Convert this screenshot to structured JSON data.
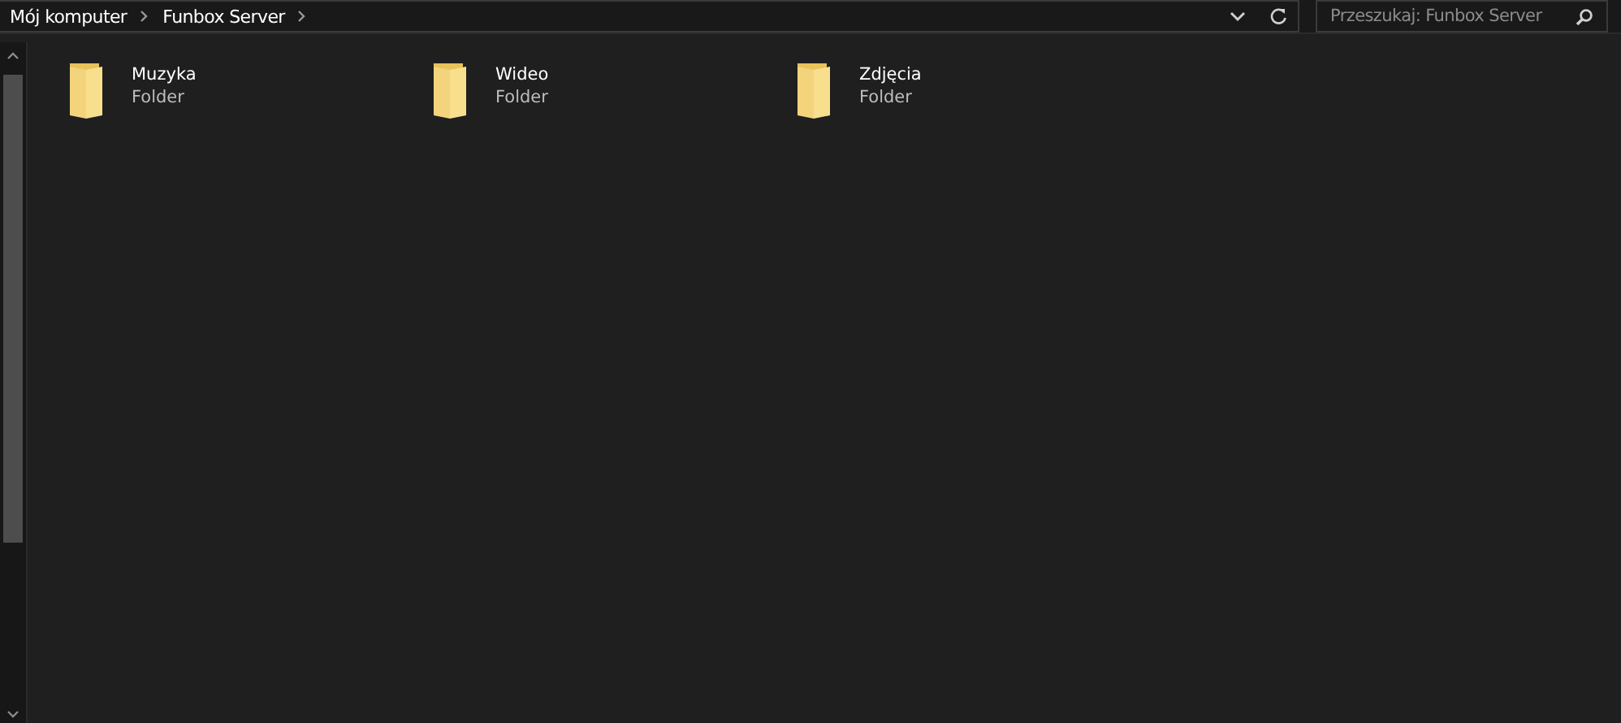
{
  "address_bar": {
    "breadcrumbs": [
      "Mój komputer",
      "Funbox Server"
    ]
  },
  "search": {
    "placeholder": "Przeszukaj: Funbox Server"
  },
  "items": [
    {
      "name": "Muzyka",
      "type": "Folder"
    },
    {
      "name": "Wideo",
      "type": "Folder"
    },
    {
      "name": "Zdjęcia",
      "type": "Folder"
    }
  ]
}
